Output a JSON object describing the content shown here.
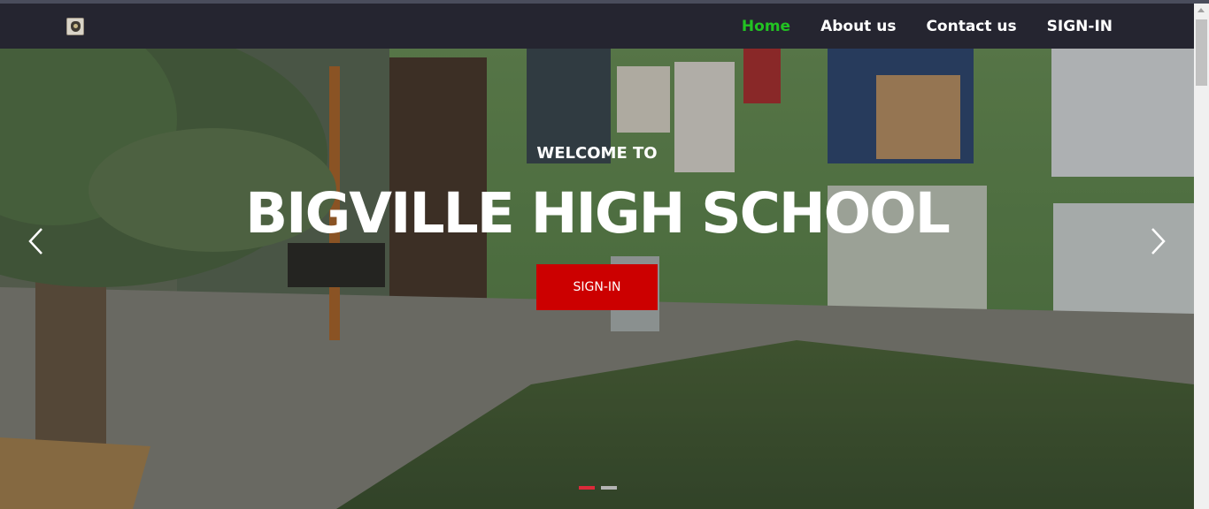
{
  "navbar": {
    "logo": "school-crest-icon",
    "links": [
      {
        "label": "Home",
        "active": true
      },
      {
        "label": "About us",
        "active": false
      },
      {
        "label": "Contact us",
        "active": false
      },
      {
        "label": "SIGN-IN",
        "active": false
      }
    ]
  },
  "hero": {
    "welcome": "WELCOME TO",
    "title": "BIGVILLE HIGH SCHOOL",
    "button": "SIGN-IN",
    "prev_icon": "chevron-left-icon",
    "next_icon": "chevron-right-icon",
    "slides_count": 2,
    "active_slide": 1
  },
  "colors": {
    "nav_bg": "#252530",
    "nav_active": "#22c322",
    "button_bg": "#cc0000",
    "indicator_active": "#dc2a3a"
  }
}
